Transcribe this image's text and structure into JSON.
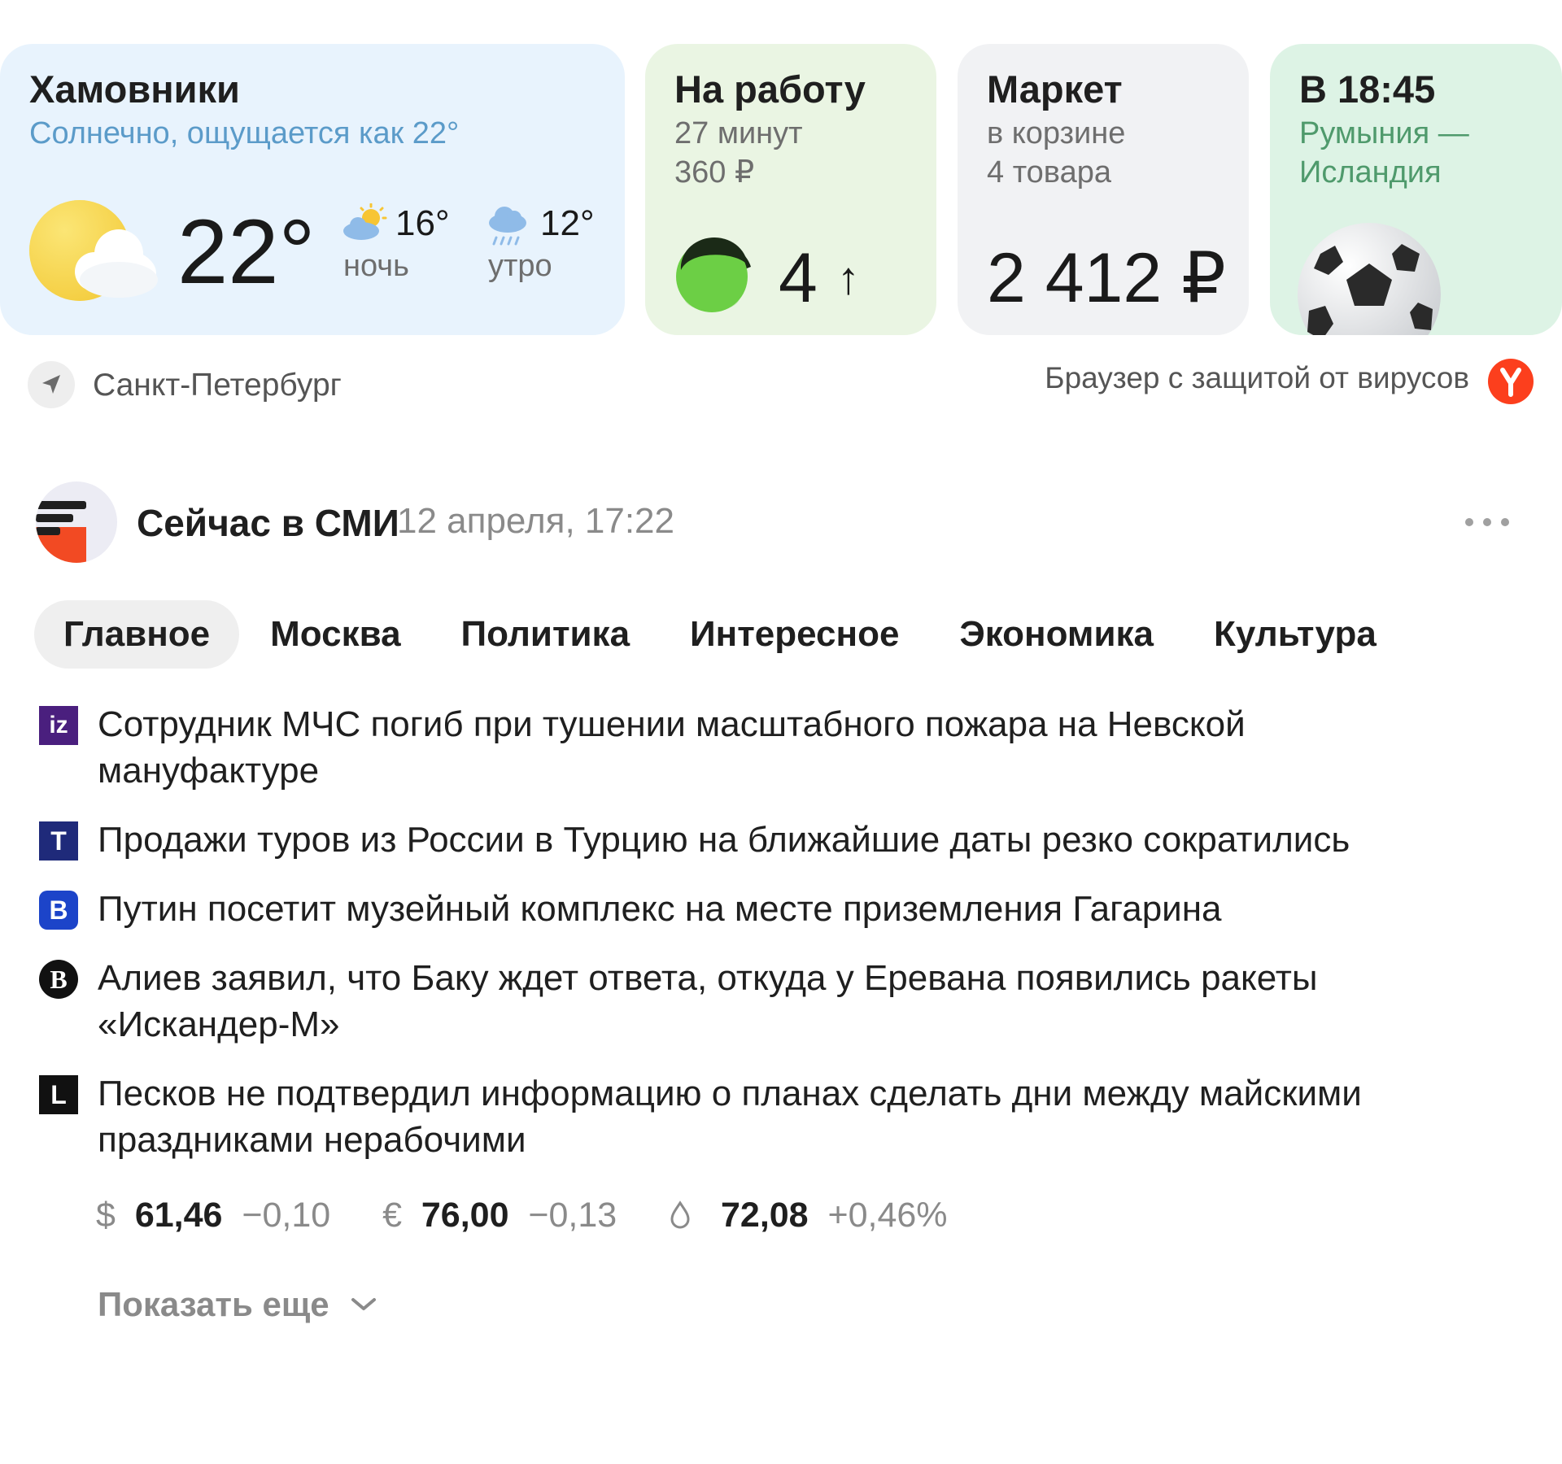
{
  "weather": {
    "location": "Хамовники",
    "description": "Солнечно, ощущается как 22°",
    "temp": "22°",
    "forecast": [
      {
        "temp": "16°",
        "label": "ночь",
        "icon": "partly-cloudy-icon"
      },
      {
        "temp": "12°",
        "label": "утро",
        "icon": "rain-icon"
      }
    ]
  },
  "work": {
    "title": "На работу",
    "subtitle": "27 минут\n360 ₽",
    "traffic_score": "4",
    "trend_arrow": "↑"
  },
  "market": {
    "title": "Маркет",
    "subtitle": "в корзине\n4 товара",
    "total": "2 412 ₽"
  },
  "sport": {
    "title": "В 18:45",
    "subtitle": "Румыния —\nИсландия",
    "icon": "soccer-ball-icon"
  },
  "location": {
    "city": "Санкт-Петербург",
    "icon": "location-arrow-icon"
  },
  "promo": {
    "text": "Браузер с защитой от вирусов",
    "logo_letter": "Y",
    "logo_color": "#fc3f1d"
  },
  "news": {
    "section_title": "Сейчас в СМИ",
    "date": "12 апреля, 17:22",
    "tabs": [
      "Главное",
      "Москва",
      "Политика",
      "Интересное",
      "Экономика",
      "Культура"
    ],
    "active_tab": 0,
    "items": [
      {
        "source_icon": "iz",
        "icon_color": "#4a1f7e",
        "text": "Сотрудник МЧС погиб при тушении масштабного пожара на Невской мануфактуре"
      },
      {
        "source_icon": "T",
        "icon_color": "#1f2a7a",
        "text": "Продажи туров из России в Турцию на ближайшие даты резко сократились"
      },
      {
        "source_icon": "B",
        "icon_color": "#1c44c9",
        "text": "Путин посетит музейный комплекс на месте приземления Гагарина"
      },
      {
        "source_icon": "B",
        "icon_color": "#111111",
        "text": "Алиев заявил, что Баку ждет ответа, откуда у Еревана появились ракеты «Искандер-М»"
      },
      {
        "source_icon": "L",
        "icon_color": "#111111",
        "text": "Песков не подтвердил информацию о планах сделать дни между майскими праздниками нерабочими"
      }
    ]
  },
  "rates": [
    {
      "symbol": "$",
      "value": "61,46",
      "change": "−0,10"
    },
    {
      "symbol": "€",
      "value": "76,00",
      "change": "−0,13"
    },
    {
      "symbol": "oil-drop-icon",
      "value": "72,08",
      "change": "+0,46%"
    }
  ],
  "show_more": "Показать еще"
}
